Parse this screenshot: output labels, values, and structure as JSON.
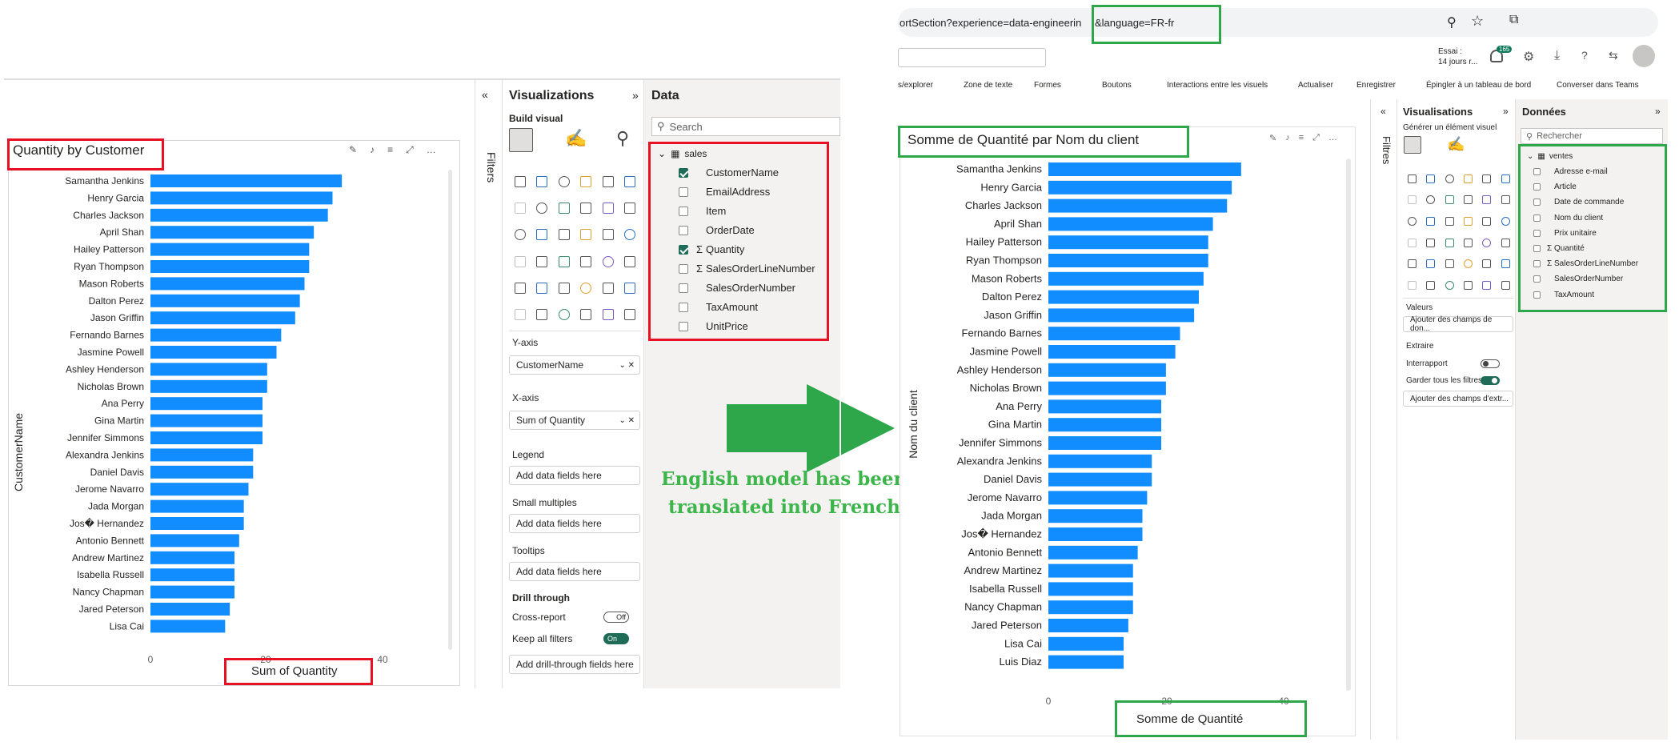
{
  "left_chart": {
    "title": "Quantity by Customer",
    "ylabel": "CustomerName",
    "xlabel": "Sum of Quantity",
    "ticks": [
      "0",
      "20",
      "40"
    ]
  },
  "left_pane": {
    "filters": "Filters",
    "viz_title": "Visualizations",
    "build_visual": "Build visual",
    "y_axis": "Y-axis",
    "y_field": "CustomerName",
    "x_axis": "X-axis",
    "x_field": "Sum of Quantity",
    "legend": "Legend",
    "add_fields": "Add data fields here",
    "small_multiples": "Small multiples",
    "tooltips": "Tooltips",
    "drill_through": "Drill through",
    "cross_report": "Cross-report",
    "off": "Off",
    "keep_filters": "Keep all filters",
    "on": "On",
    "add_drill": "Add drill-through fields here",
    "data_title": "Data",
    "search": "Search",
    "table": "sales",
    "fields": [
      {
        "name": "CustomerName",
        "checked": true,
        "sigma": false
      },
      {
        "name": "EmailAddress",
        "checked": false,
        "sigma": false
      },
      {
        "name": "Item",
        "checked": false,
        "sigma": false
      },
      {
        "name": "OrderDate",
        "checked": false,
        "sigma": false
      },
      {
        "name": "Quantity",
        "checked": true,
        "sigma": true
      },
      {
        "name": "SalesOrderLineNumber",
        "checked": false,
        "sigma": true
      },
      {
        "name": "SalesOrderNumber",
        "checked": false,
        "sigma": false
      },
      {
        "name": "TaxAmount",
        "checked": false,
        "sigma": false
      },
      {
        "name": "UnitPrice",
        "checked": false,
        "sigma": false
      }
    ]
  },
  "callout": {
    "line1": "English model has been",
    "line2": "translated into French"
  },
  "browser": {
    "url_part1": "ortSection?experience=data-engineerin",
    "url_part2": "&language=FR-fr",
    "trial_line1": "Essai :",
    "trial_line2": "14 jours r...",
    "badge": "165"
  },
  "ribbon": [
    {
      "label": "s/explorer"
    },
    {
      "label": "Zone de texte"
    },
    {
      "label": "Formes"
    },
    {
      "label": "Boutons"
    },
    {
      "label": "Interactions entre les visuels"
    },
    {
      "label": "Actualiser"
    },
    {
      "label": "Enregistrer"
    },
    {
      "label": "Épingler à un tableau de bord"
    },
    {
      "label": "Converser dans Teams"
    }
  ],
  "right_chart": {
    "title": "Somme de Quantité par Nom du client",
    "ylabel": "Nom du client",
    "xlabel": "Somme de Quantité",
    "ticks": [
      "0",
      "20",
      "40"
    ]
  },
  "right_pane": {
    "filters": "Filtres",
    "viz_title": "Visualisations",
    "build_visual": "Générer un élément visuel",
    "values": "Valeurs",
    "add_values": "Ajouter des champs de don...",
    "extract": "Extraire",
    "interreport": "Interrapport",
    "keep_filters": "Garder tous les filtres",
    "add_extract": "Ajouter des champs d'extr...",
    "data_title": "Données",
    "search": "Rechercher",
    "table": "ventes",
    "fields": [
      {
        "name": "Adresse e-mail",
        "sigma": false
      },
      {
        "name": "Article",
        "sigma": false
      },
      {
        "name": "Date de commande",
        "sigma": false
      },
      {
        "name": "Nom du client",
        "sigma": false
      },
      {
        "name": "Prix unitaire",
        "sigma": false
      },
      {
        "name": "Quantité",
        "sigma": true
      },
      {
        "name": "SalesOrderLineNumber",
        "sigma": true
      },
      {
        "name": "SalesOrderNumber",
        "sigma": false
      },
      {
        "name": "TaxAmount",
        "sigma": false
      }
    ]
  },
  "colors": {
    "bar": "#118dff",
    "red": "#e81123",
    "green": "#2ea64a",
    "callout": "#3cb54a"
  },
  "chart_data": [
    {
      "type": "bar",
      "orientation": "horizontal",
      "title": "Quantity by Customer",
      "xlabel": "Sum of Quantity",
      "ylabel": "CustomerName",
      "xlim": [
        0,
        48
      ],
      "categories": [
        "Samantha Jenkins",
        "Henry Garcia",
        "Charles Jackson",
        "April Shan",
        "Hailey Patterson",
        "Ryan Thompson",
        "Mason Roberts",
        "Dalton Perez",
        "Jason Griffin",
        "Fernando Barnes",
        "Jasmine Powell",
        "Ashley Henderson",
        "Nicholas Brown",
        "Ana Perry",
        "Gina Martin",
        "Jennifer Simmons",
        "Alexandra Jenkins",
        "Daniel Davis",
        "Jerome Navarro",
        "Jada Morgan",
        "Jos� Hernandez",
        "Antonio Bennett",
        "Andrew Martinez",
        "Isabella Russell",
        "Nancy Chapman",
        "Jared Peterson",
        "Lisa Cai"
      ],
      "values": [
        41,
        39,
        38,
        35,
        34,
        34,
        33,
        32,
        31,
        28,
        27,
        25,
        25,
        24,
        24,
        24,
        22,
        22,
        21,
        20,
        20,
        19,
        18,
        18,
        18,
        17,
        16
      ]
    },
    {
      "type": "bar",
      "orientation": "horizontal",
      "title": "Somme de Quantité par Nom du client",
      "xlabel": "Somme de Quantité",
      "ylabel": "Nom du client",
      "xlim": [
        0,
        48
      ],
      "categories": [
        "Samantha Jenkins",
        "Henry Garcia",
        "Charles Jackson",
        "April Shan",
        "Hailey Patterson",
        "Ryan Thompson",
        "Mason Roberts",
        "Dalton Perez",
        "Jason Griffin",
        "Fernando Barnes",
        "Jasmine Powell",
        "Ashley Henderson",
        "Nicholas Brown",
        "Ana Perry",
        "Gina Martin",
        "Jennifer Simmons",
        "Alexandra Jenkins",
        "Daniel Davis",
        "Jerome Navarro",
        "Jada Morgan",
        "Jos� Hernandez",
        "Antonio Bennett",
        "Andrew Martinez",
        "Isabella Russell",
        "Nancy Chapman",
        "Jared Peterson",
        "Lisa Cai",
        "Luis Diaz"
      ],
      "values": [
        41,
        39,
        38,
        35,
        34,
        34,
        33,
        32,
        31,
        28,
        27,
        25,
        25,
        24,
        24,
        24,
        22,
        22,
        21,
        20,
        20,
        19,
        18,
        18,
        18,
        17,
        16,
        16
      ]
    }
  ]
}
